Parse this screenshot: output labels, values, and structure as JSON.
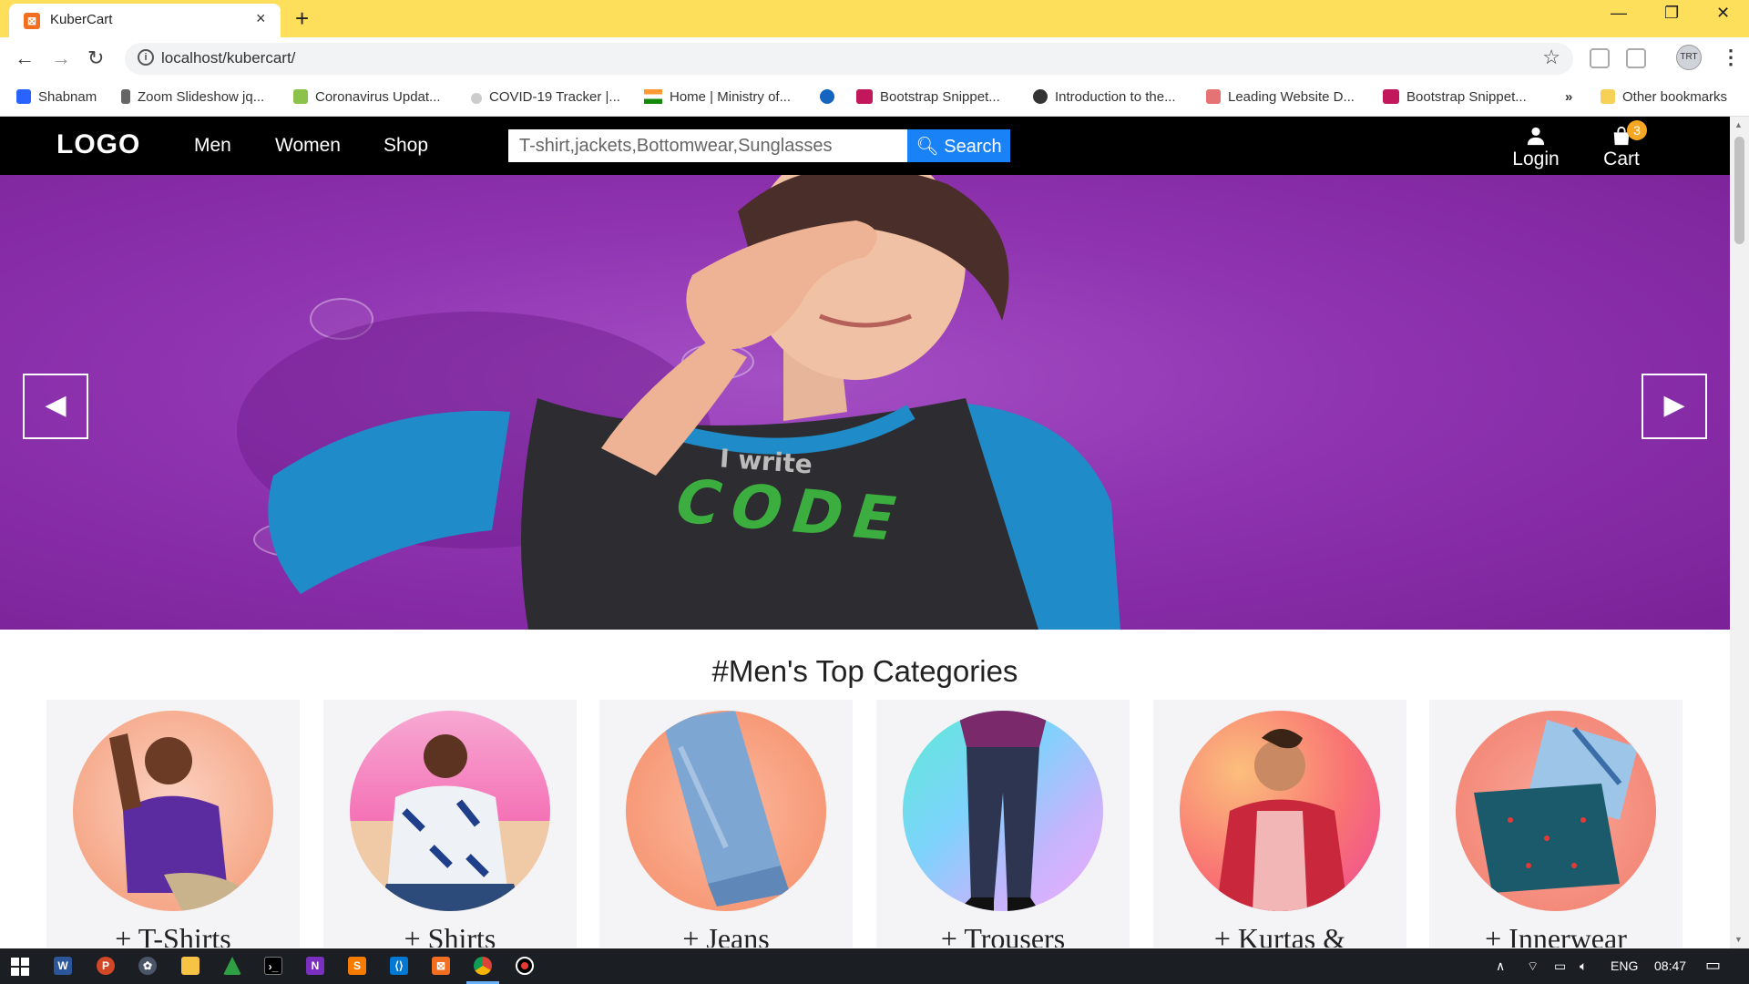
{
  "browser": {
    "tab_title": "KuberCart",
    "tab_favicon": "xampp-icon",
    "tab_close": "×",
    "new_tab": "+",
    "url": "localhost/kubercart/",
    "bookmarks": [
      {
        "label": "Shabnam",
        "icon": "infinity-icon",
        "color": "#2962ff"
      },
      {
        "label": "Zoom Slideshow jq...",
        "icon": "page-icon",
        "color": "#666666"
      },
      {
        "label": "Coronavirus Updat...",
        "icon": "w-icon",
        "color": "#8bc34a"
      },
      {
        "label": "COVID-19 Tracker |...",
        "icon": "globe-icon",
        "color": "#bbbbbb"
      },
      {
        "label": "Home | Ministry of...",
        "icon": "india-flag-icon",
        "color": "#ff9933"
      },
      {
        "label": "",
        "icon": "g-icon",
        "color": "#1565c0"
      },
      {
        "label": "Bootstrap Snippet...",
        "icon": "m-icon",
        "color": "#c2185b"
      },
      {
        "label": "Introduction to the...",
        "icon": "globe-dark-icon",
        "color": "#333333"
      },
      {
        "label": "Leading Website D...",
        "icon": "chart-icon",
        "color": "#e57373"
      },
      {
        "label": "Bootstrap Snippet...",
        "icon": "m-icon",
        "color": "#c2185b"
      }
    ],
    "bookmarks_overflow": "»",
    "other_bookmarks": "Other bookmarks"
  },
  "site": {
    "logo": "LOGO",
    "nav": [
      "Men",
      "Women",
      "Shop"
    ],
    "search_placeholder": "T-shirt,jackets,Bottomwear,Sunglasses",
    "search_button": "Search",
    "login": "Login",
    "cart": "Cart",
    "cart_count": "3"
  },
  "carousel": {
    "shirt_text_top": "I write",
    "shirt_text_bottom": "CODE",
    "prev_arrow": "◀",
    "next_arrow": "▶"
  },
  "categories": {
    "title": "#Men's Top Categories",
    "items": [
      {
        "label": "+ T-Shirts",
        "bg": "#f6a98a"
      },
      {
        "label": "+ Shirts",
        "bg": "#f472b6"
      },
      {
        "label": "+ Jeans",
        "bg": "#f79a78"
      },
      {
        "label": "+ Trousers",
        "bg": "#7dd3fc"
      },
      {
        "label": "+ Kurtas &",
        "bg": "#f97373"
      },
      {
        "label": "+ Innerwear",
        "bg": "#f48a7a"
      }
    ]
  },
  "taskbar": {
    "language": "ENG",
    "time": "08:47"
  },
  "colors": {
    "chrome_bar": "#fddf5b",
    "site_nav": "#000000",
    "search_button": "#1a82f7",
    "carousel_purple": "#8f33b0",
    "cart_badge": "#f5a623"
  }
}
